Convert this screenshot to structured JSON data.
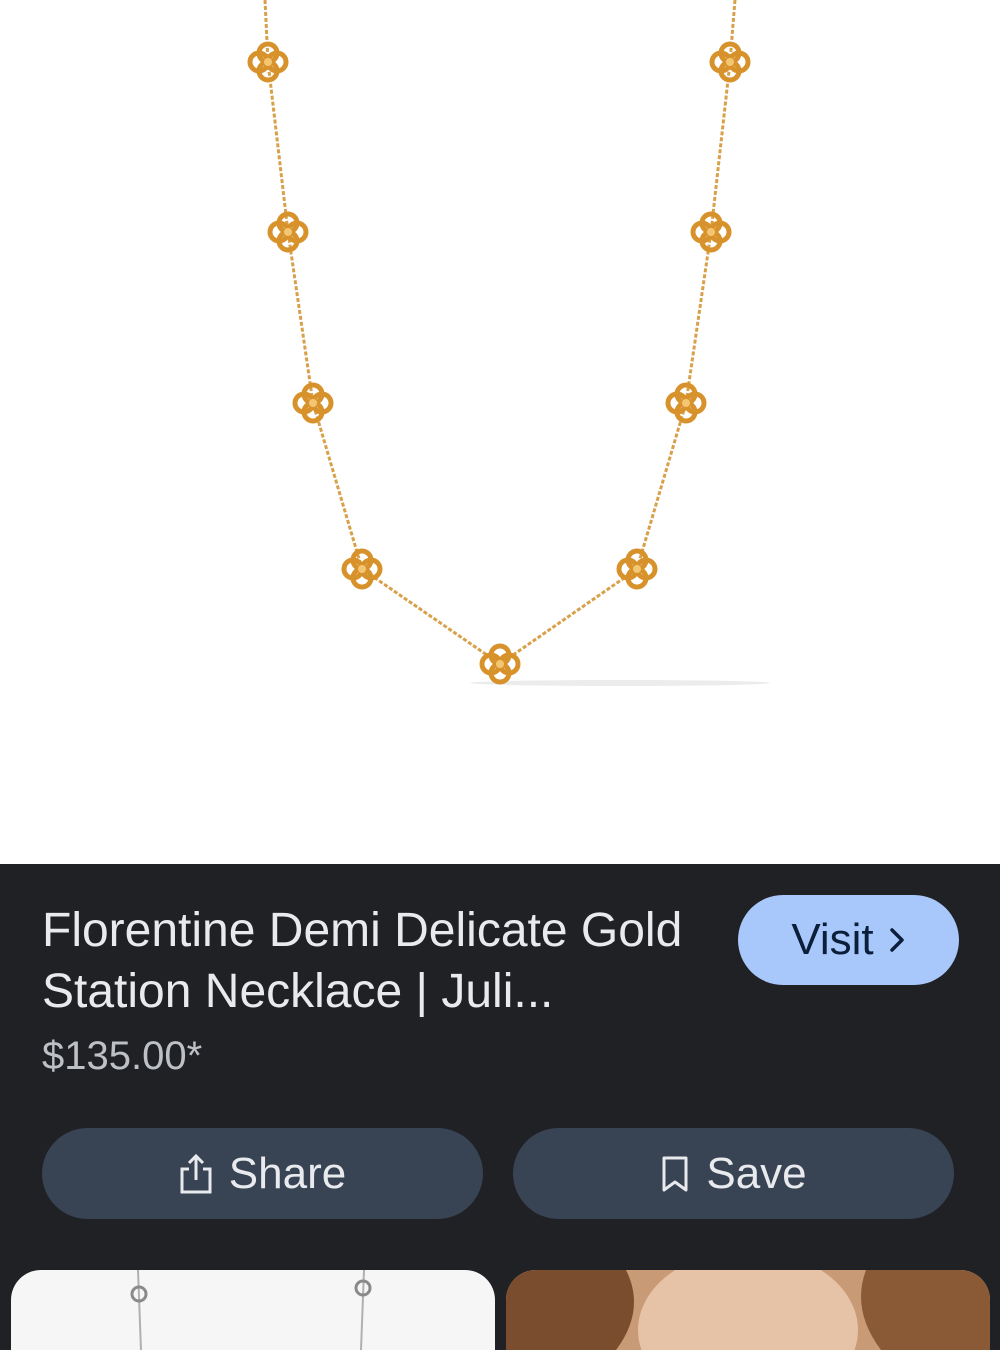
{
  "product": {
    "title": "Florentine Demi Delicate Gold Station Necklace | Juli...",
    "price": "$135.00*"
  },
  "buttons": {
    "visit_label": "Visit",
    "share_label": "Share",
    "save_label": "Save"
  },
  "icons": {
    "visit": "chevron-right-icon",
    "share": "share-icon",
    "save": "bookmark-icon"
  },
  "colors": {
    "panel_background": "#202124",
    "visit_button": "#a8c7fa",
    "action_button": "#384354",
    "gold": "#e0a23c"
  },
  "related_images": [
    {
      "name": "related-necklace-silver"
    },
    {
      "name": "related-model-photo"
    }
  ]
}
